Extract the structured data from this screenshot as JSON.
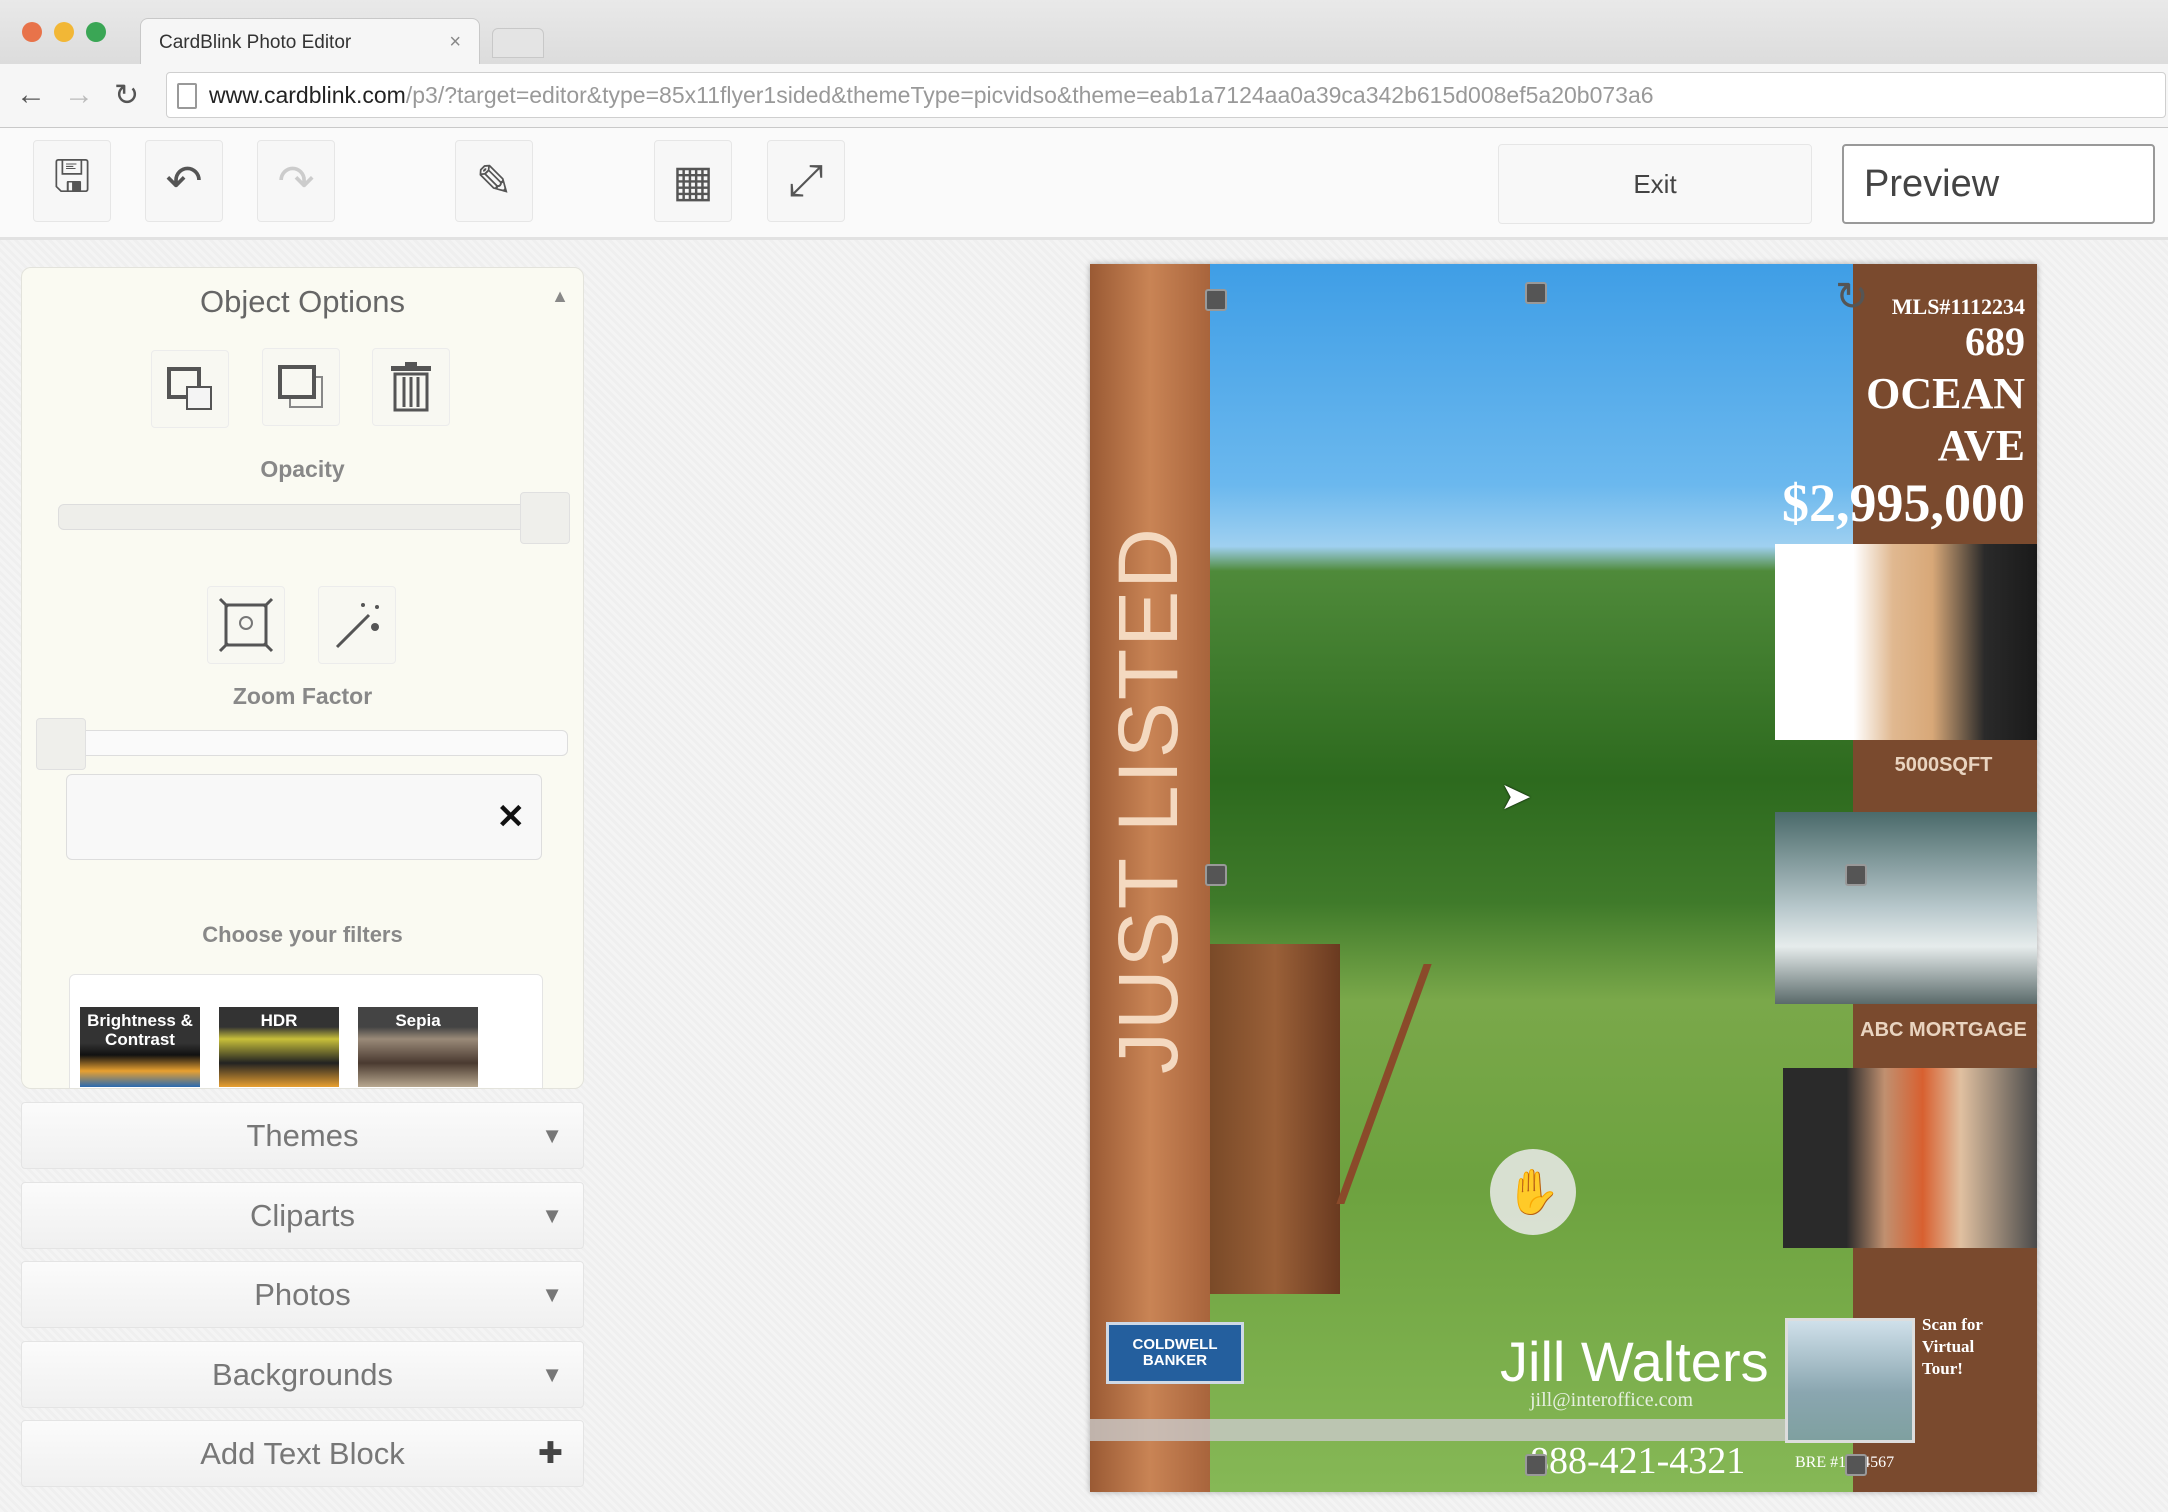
{
  "browser": {
    "tab_title": "CardBlink Photo Editor",
    "tab_close": "×",
    "url_host": "www.cardblink.com",
    "url_path": "/p3/?target=editor&type=85x11flyer1sided&themeType=picvidso&theme=eab1a7124aa0a39ca342b615d008ef5a20b073a6",
    "back": "←",
    "forward": "→",
    "reload": "↻"
  },
  "toolbar": {
    "save_icon": "floppy-disk",
    "undo_icon": "undo-arrow",
    "redo_icon": "redo-arrow",
    "edit_icon": "pencil",
    "grid_icon": "grid",
    "fullscreen_icon": "expand-arrows",
    "exit_label": "Exit",
    "preview_label": "Preview"
  },
  "object_options": {
    "title": "Object Options",
    "opacity_label": "Opacity",
    "opacity_value": 1.0,
    "zoom_label": "Zoom Factor",
    "zoom_value": 0.0,
    "clear": "✕",
    "filters_label": "Choose your filters",
    "filters": [
      "Brightness & Contrast",
      "HDR",
      "Sepia"
    ]
  },
  "accordion": [
    {
      "label": "Themes",
      "icon": "▼"
    },
    {
      "label": "Cliparts",
      "icon": "▼"
    },
    {
      "label": "Photos",
      "icon": "▼"
    },
    {
      "label": "Backgrounds",
      "icon": "▼"
    },
    {
      "label": "Add Text Block",
      "icon": "✚"
    }
  ],
  "flyer": {
    "banner": "JUST LISTED",
    "mls": "MLS#1112234",
    "address_line1": "689",
    "address_line2": "OCEAN",
    "address_line3": "AVE",
    "price": "$2,995,000",
    "caption1": "5000SQFT",
    "caption2": "ABC MORTGAGE",
    "agent_name": "Jill Walters",
    "agent_email": "jill@interoffice.com",
    "agent_phone": "888-421-4321",
    "broker_logo": "COLDWELL BANKER",
    "scan_text": "Scan for Virtual Tour!",
    "broker_id": "BRE #1234567"
  },
  "colors": {
    "flyer_brown": "#7a4a2e",
    "strip_orange": "#c98455",
    "panel_bg": "#fafaf2"
  }
}
